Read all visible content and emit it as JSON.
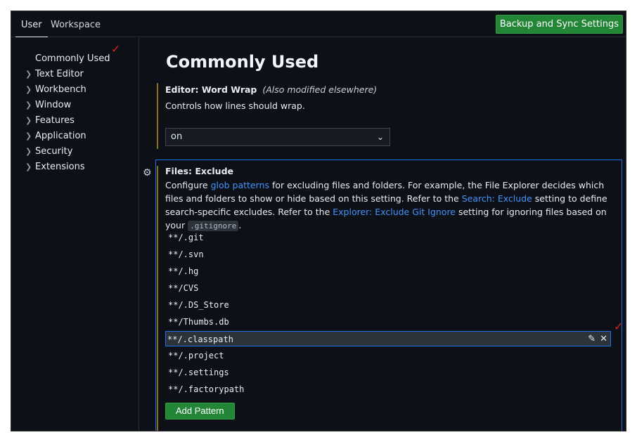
{
  "tabs": [
    {
      "label": "User"
    },
    {
      "label": "Workspace"
    }
  ],
  "sync_button": {
    "label": "Backup and Sync Settings"
  },
  "sidebar": {
    "items": [
      {
        "label": "Commonly Used",
        "expandable": false
      },
      {
        "label": "Text Editor",
        "expandable": true
      },
      {
        "label": "Workbench",
        "expandable": true
      },
      {
        "label": "Window",
        "expandable": true
      },
      {
        "label": "Features",
        "expandable": true
      },
      {
        "label": "Application",
        "expandable": true
      },
      {
        "label": "Security",
        "expandable": true
      },
      {
        "label": "Extensions",
        "expandable": true
      }
    ]
  },
  "page_title": "Commonly Used",
  "word_wrap": {
    "category": "Editor: ",
    "name": "Word Wrap",
    "modified_note": "(Also modified elsewhere)",
    "description": "Controls how lines should wrap.",
    "value": "on"
  },
  "files_exclude": {
    "title": "Files: Exclude",
    "desc_1": "Configure ",
    "link_glob": "glob patterns",
    "desc_2": " for excluding files and folders. For example, the File Explorer decides which files and folders to show or hide based on this setting. Refer to the ",
    "link_search": "Search: Exclude",
    "desc_3": " setting to define search-specific excludes. Refer to the ",
    "link_explorer": "Explorer: Exclude Git Ignore",
    "desc_4": " setting for ignoring files based on your ",
    "code": ".gitignore",
    "desc_5": ".",
    "patterns": [
      "**/.git",
      "**/.svn",
      "**/.hg",
      "**/CVS",
      "**/.DS_Store",
      "**/Thumbs.db",
      "**/.classpath",
      "**/.project",
      "**/.settings",
      "**/.factorypath"
    ],
    "selected_pattern_index": 6,
    "add_button": "Add Pattern"
  },
  "icons": {
    "chevron": "chevron-right-icon",
    "caret": "chevron-down-icon",
    "gear": "gear-icon",
    "edit": "pencil-icon",
    "remove": "close-icon",
    "annotation": "red-checkmark"
  },
  "colors": {
    "background": "#0d1117",
    "accent_green": "#238636",
    "link_blue": "#4493f8",
    "focus_border": "#1f6feb",
    "modified_indicator": "#8a6d1f",
    "annotation_red": "#e02020"
  }
}
